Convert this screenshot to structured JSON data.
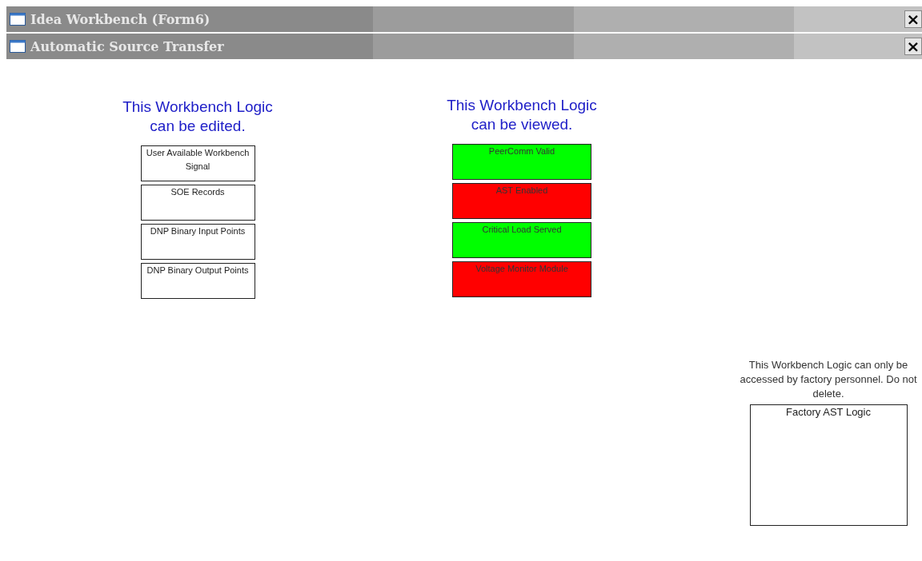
{
  "windows": [
    {
      "title": "Idea Workbench (Form6)",
      "close": "×"
    },
    {
      "title": "Automatic Source Transfer",
      "close": "×"
    }
  ],
  "editable": {
    "heading": "This Workbench Logic can be edited.",
    "blocks": [
      "User Available Workbench Signal",
      "SOE Records",
      "DNP Binary Input Points",
      "DNP Binary Output Points"
    ]
  },
  "viewable": {
    "heading": "This Workbench Logic can be viewed.",
    "blocks": [
      {
        "label": "PeerComm Valid",
        "color": "#00ff00"
      },
      {
        "label": "AST Enabled",
        "color": "#ff0000"
      },
      {
        "label": "Critical Load Served",
        "color": "#00ff00"
      },
      {
        "label": "Voltage Monitor Module",
        "color": "#ff0000"
      }
    ]
  },
  "factory": {
    "note": "This Workbench Logic can only be accessed by factory personnel.  Do not delete.",
    "block": "Factory AST Logic"
  }
}
